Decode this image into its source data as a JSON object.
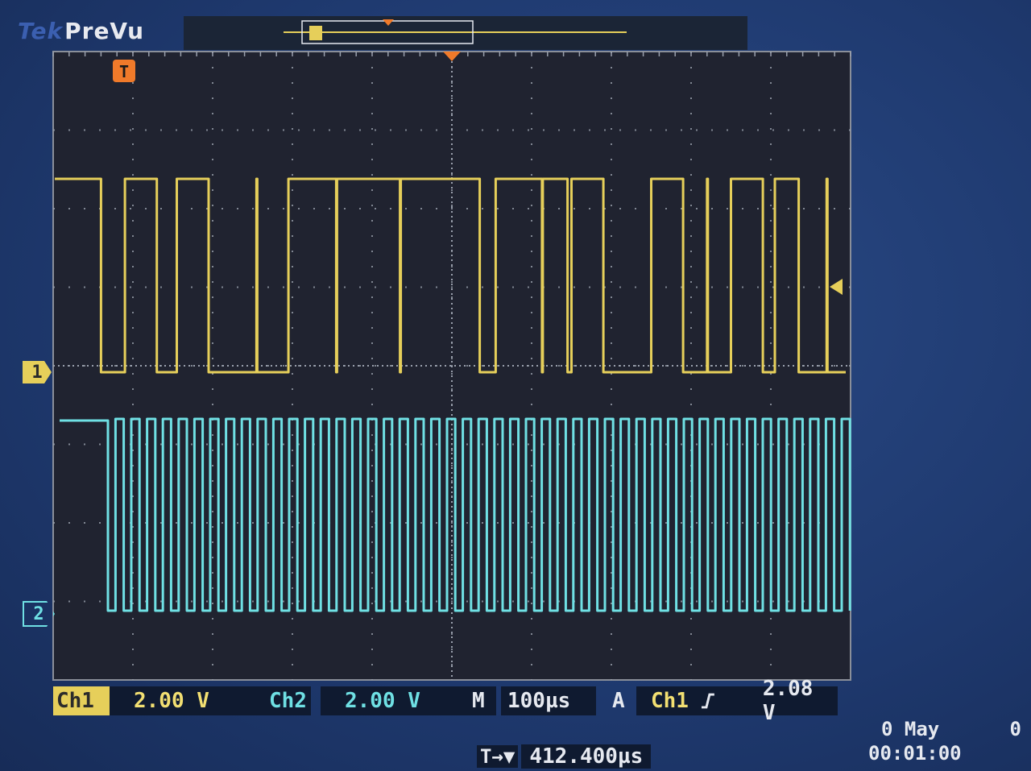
{
  "header": {
    "brand_tek": "Tek",
    "brand_mode": "PreVu"
  },
  "channels": {
    "ch1": {
      "marker": "1",
      "label": "Ch1",
      "scale": "2.00 V",
      "color": "#e6cf5a"
    },
    "ch2": {
      "marker": "2",
      "label": "Ch2",
      "scale": "2.00 V",
      "color": "#6fe0e4"
    }
  },
  "timebase": {
    "label": "M",
    "value": "100µs"
  },
  "trigger": {
    "label": "A",
    "source": "Ch1",
    "edge": "rising-edge-icon",
    "level": "2.08 V",
    "position_value": "412.400µs",
    "marker_letter": "T"
  },
  "datetime": {
    "date": "0 May",
    "extra": "0",
    "time": "00:01:00"
  },
  "waveforms": {
    "ch1_transitions_div": [
      0.6,
      0.9,
      1.3,
      1.55,
      1.95,
      2.55,
      2.56,
      2.95,
      3.55,
      3.56,
      4.35,
      4.36,
      5.35,
      5.55,
      6.13,
      6.14,
      6.45,
      6.5,
      6.9,
      7.5,
      7.9,
      8.2,
      8.21,
      8.5,
      8.9,
      9.05,
      9.35,
      9.7,
      9.71
    ]
  },
  "colors": {
    "graticule_bg": "#202330",
    "grid_dots": "#9aa0ad",
    "trigger_marker": "#f07a2a",
    "bezel": "#1f3a70"
  }
}
